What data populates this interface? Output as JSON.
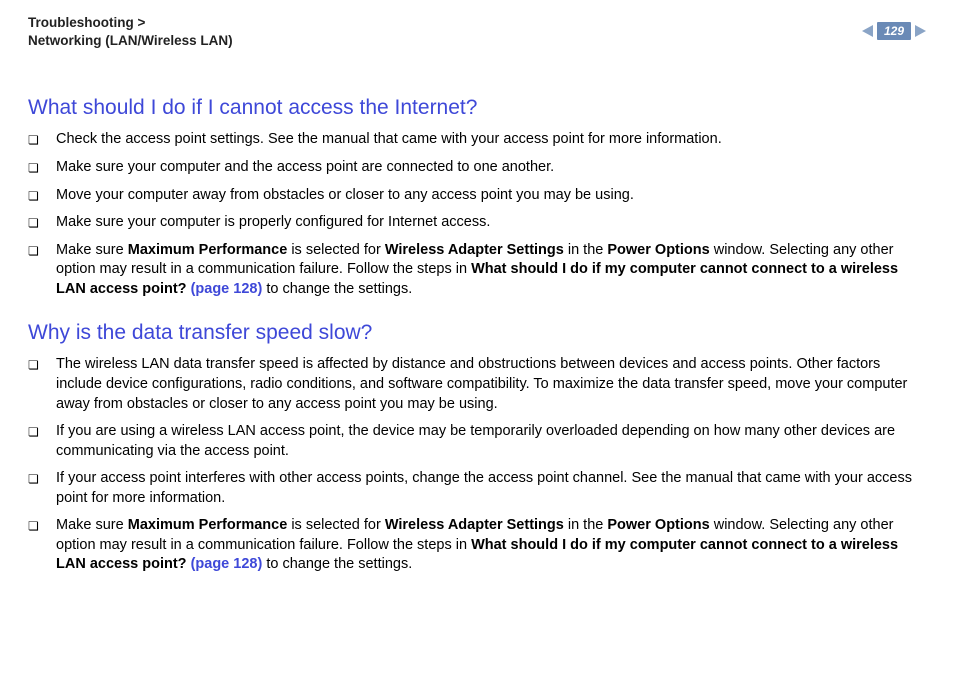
{
  "header": {
    "breadcrumb_line1": "Troubleshooting >",
    "breadcrumb_line2": "Networking (LAN/Wireless LAN)",
    "page_number": "129"
  },
  "section1": {
    "title": "What should I do if I cannot access the Internet?",
    "items": {
      "i0": "Check the access point settings. See the manual that came with your access point for more information.",
      "i1": "Make sure your computer and the access point are connected to one another.",
      "i2": "Move your computer away from obstacles or closer to any access point you may be using.",
      "i3": "Make sure your computer is properly configured for Internet access.",
      "i4_pre": "Make sure ",
      "i4_b1": "Maximum Performance",
      "i4_mid1": " is selected for ",
      "i4_b2": "Wireless Adapter Settings",
      "i4_mid2": " in the ",
      "i4_b3": "Power Options",
      "i4_mid3": " window. Selecting any other option may result in a communication failure. Follow the steps in ",
      "i4_b4": "What should I do if my computer cannot connect to a wireless LAN access point? ",
      "i4_link": "(page 128)",
      "i4_post": " to change the settings."
    }
  },
  "section2": {
    "title": "Why is the data transfer speed slow?",
    "items": {
      "i0": "The wireless LAN data transfer speed is affected by distance and obstructions between devices and access points. Other factors include device configurations, radio conditions, and software compatibility. To maximize the data transfer speed, move your computer away from obstacles or closer to any access point you may be using.",
      "i1": "If you are using a wireless LAN access point, the device may be temporarily overloaded depending on how many other devices are communicating via the access point.",
      "i2": "If your access point interferes with other access points, change the access point channel. See the manual that came with your access point for more information.",
      "i3_pre": "Make sure ",
      "i3_b1": "Maximum Performance",
      "i3_mid1": " is selected for ",
      "i3_b2": "Wireless Adapter Settings",
      "i3_mid2": " in the ",
      "i3_b3": "Power Options",
      "i3_mid3": " window. Selecting any other option may result in a communication failure. Follow the steps in ",
      "i3_b4": "What should I do if my computer cannot connect to a wireless LAN access point? ",
      "i3_link": "(page 128)",
      "i3_post": " to change the settings."
    }
  }
}
